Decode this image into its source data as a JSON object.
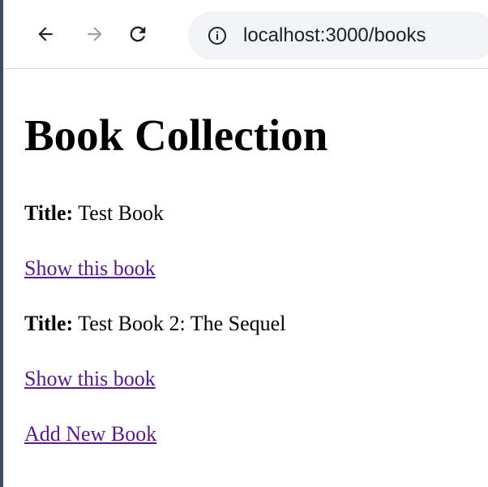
{
  "browser": {
    "url": "localhost:3000/books"
  },
  "page": {
    "heading": "Book Collection",
    "books": [
      {
        "title_label": "Title:",
        "title": "Test Book",
        "link": "Show this book"
      },
      {
        "title_label": "Title:",
        "title": "Test Book 2: The Sequel",
        "link": "Show this book"
      }
    ],
    "add_link": "Add New Book"
  },
  "icons": {
    "back": "arrow-left-icon",
    "forward": "arrow-right-icon",
    "reload": "reload-icon",
    "info": "info-icon"
  },
  "colors": {
    "link_visited": "#551a8b",
    "omnibox_bg": "#f1f3f4",
    "icon_dark": "#5f6368"
  }
}
